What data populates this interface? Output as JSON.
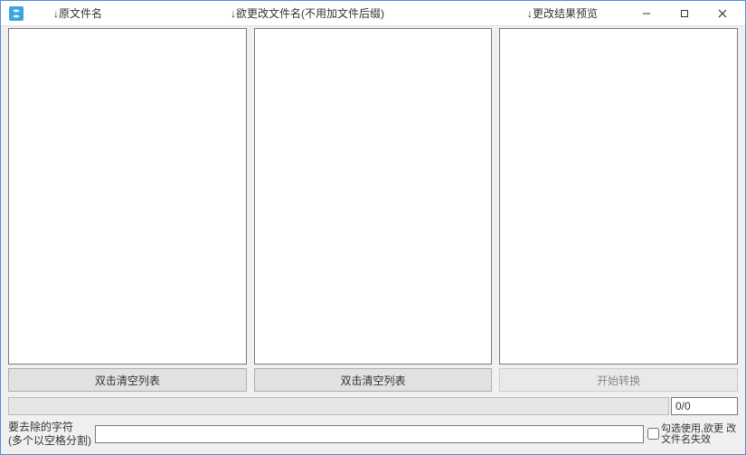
{
  "header": {
    "label_original": "↓原文件名",
    "label_desired": "↓欲更改文件名(不用加文件后缀)",
    "label_preview": "↓更改结果预览"
  },
  "columns": {
    "original": {
      "clear_btn": "双击清空列表"
    },
    "desired": {
      "clear_btn": "双击清空列表"
    },
    "preview": {
      "start_btn": "开始转换"
    }
  },
  "progress": {
    "count": "0/0"
  },
  "bottom": {
    "remove_label": "要去除的字符\n(多个以空格分割)",
    "remove_value": "",
    "checkbox_label": "勾选使用,欲更\n改文件名失效",
    "checkbox_checked": false
  },
  "icons": {
    "app": "app-icon"
  }
}
